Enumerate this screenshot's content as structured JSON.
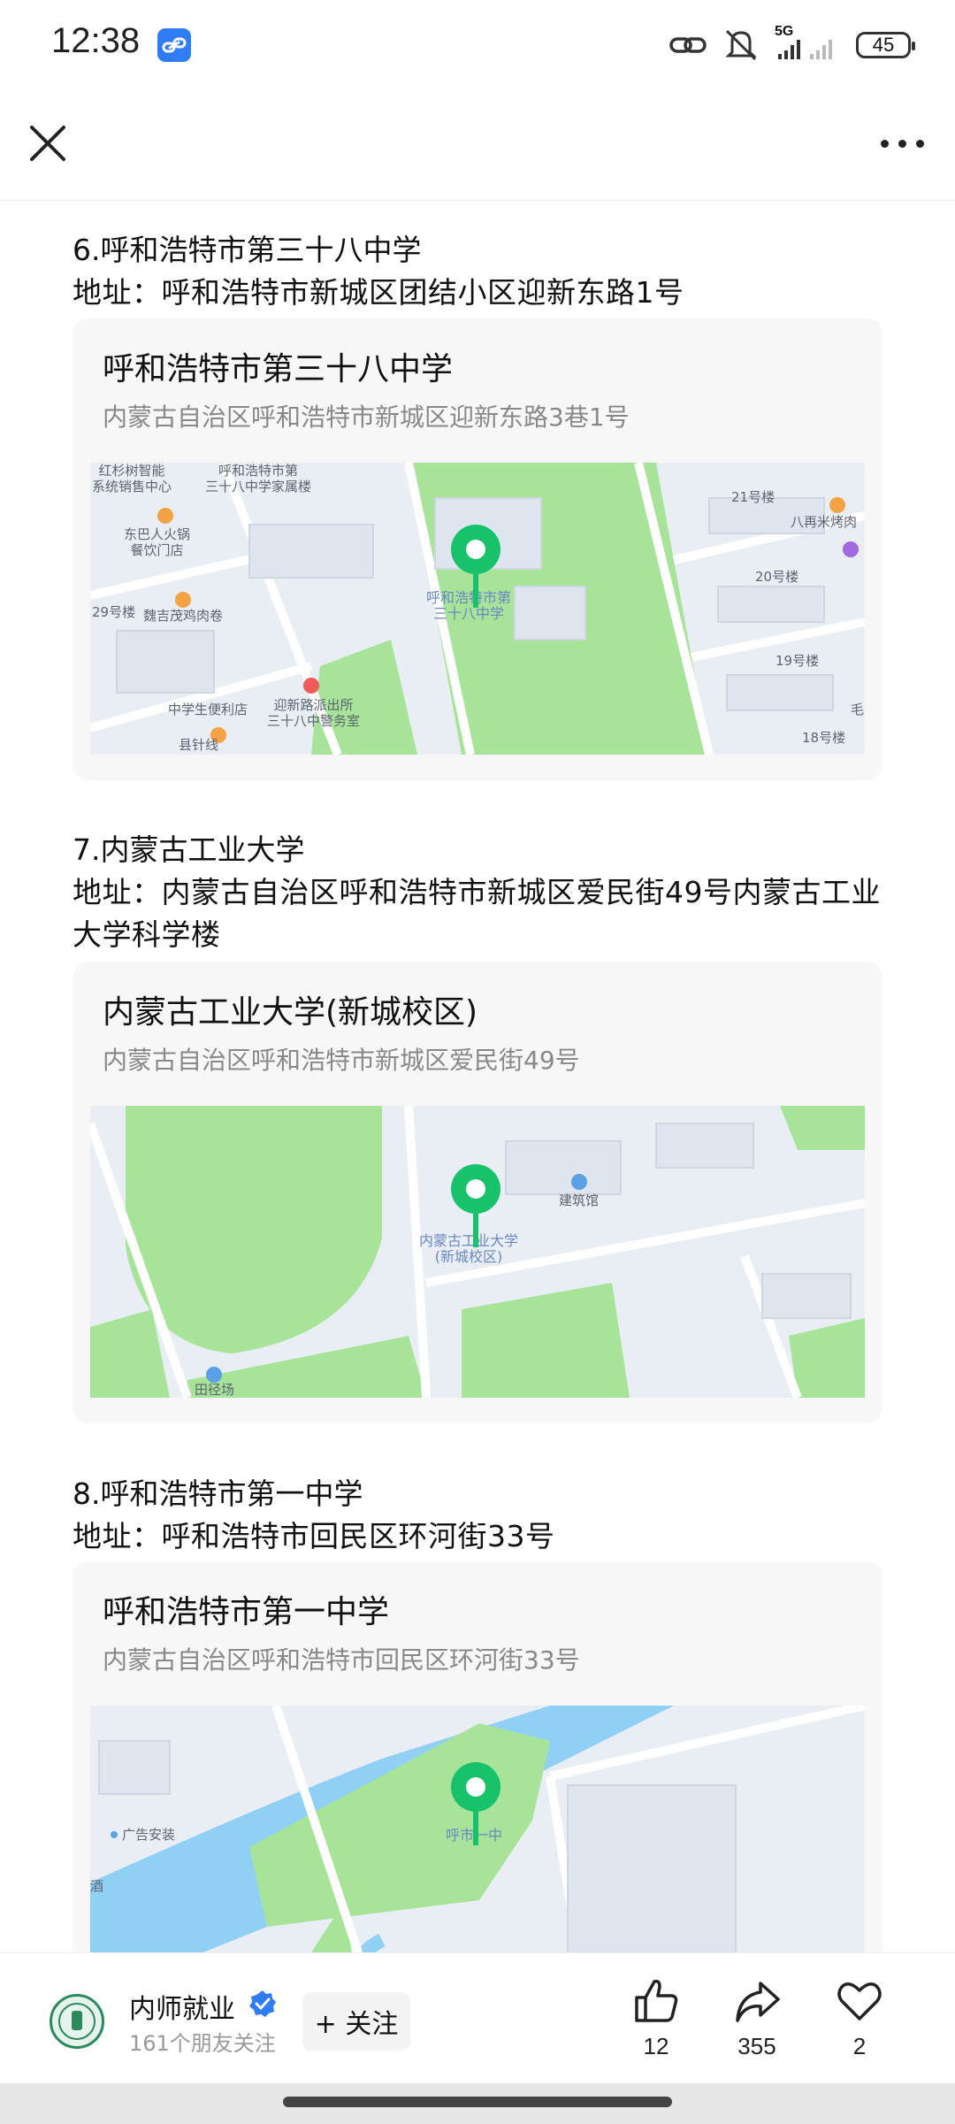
{
  "status": {
    "time": "12:38",
    "network": "5G",
    "battery": "45"
  },
  "sections": [
    {
      "title": "6.呼和浩特市第三十八中学",
      "address_line": "地址：呼和浩特市新城区团结小区迎新东路1号",
      "card": {
        "name": "呼和浩特市第三十八中学",
        "address": "内蒙古自治区呼和浩特市新城区迎新东路3巷1号"
      },
      "map_labels": {
        "pin": "呼和浩特市第\n三十八中学",
        "a": "红杉树智能\n系统销售中心",
        "b": "呼和浩特市第\n三十八中学家属楼",
        "c": "东巴人火锅\n餐饮门店",
        "d": "29号楼",
        "e": "魏吉茂鸡肉卷",
        "f": "中学生便利店",
        "g": "迎新路派出所\n三十八中警务室",
        "h": "21号楼",
        "i": "八再米烤肉",
        "j": "20号楼",
        "k": "19号楼",
        "l": "18号楼",
        "m": "毛",
        "n": "县针线"
      }
    },
    {
      "title": "7.内蒙古工业大学",
      "address_line": "地址：内蒙古自治区呼和浩特市新城区爱民街49号内蒙古工业大学科学楼",
      "card": {
        "name": "内蒙古工业大学(新城校区)",
        "address": "内蒙古自治区呼和浩特市新城区爱民街49号"
      },
      "map_labels": {
        "pin": "内蒙古工业大学\n(新城校区)",
        "a": "建筑馆",
        "b": "田径场"
      }
    },
    {
      "title": "8.呼和浩特市第一中学",
      "address_line": "地址：呼和浩特市回民区环河街33号",
      "card": {
        "name": "呼和浩特市第一中学",
        "address": "内蒙古自治区呼和浩特市回民区环河街33号"
      },
      "map_labels": {
        "pin": "呼市一中",
        "a": "广告安装",
        "b": "酒"
      }
    }
  ],
  "footer": {
    "author": "内师就业",
    "followers": "161个朋友关注",
    "follow_label": "+ 关注",
    "likes": "12",
    "shares": "355",
    "favorites": "2"
  },
  "icons": {
    "close": "close-icon",
    "more": "more-icon",
    "like": "thumbs-up-icon",
    "share": "share-icon",
    "favorite": "heart-icon",
    "verified": "verified-check-icon"
  },
  "colors": {
    "pin": "#17c26b",
    "park": "#a8e39a",
    "water": "#8fd0f4",
    "verified": "#2f7cf6"
  }
}
